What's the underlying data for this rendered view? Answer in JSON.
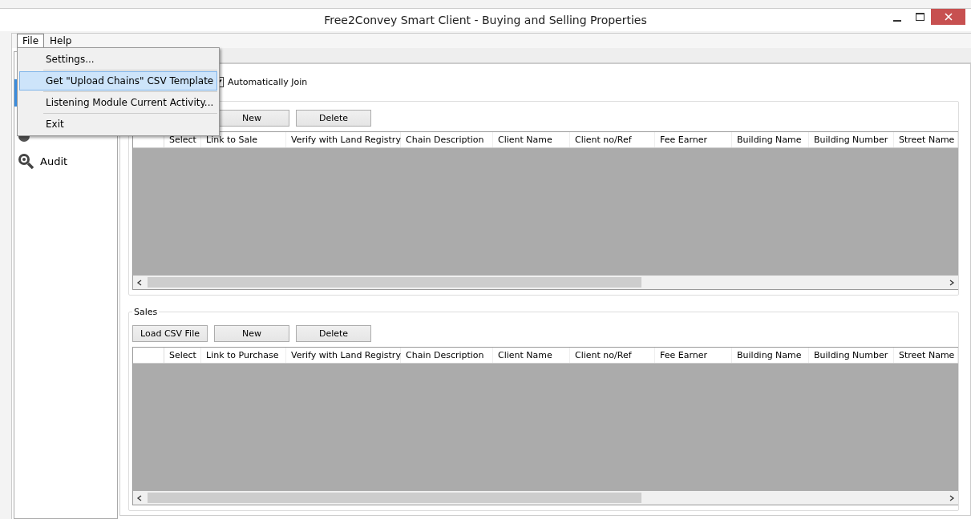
{
  "window": {
    "title": "Free2Convey Smart Client - Buying and Selling Properties"
  },
  "menu_bar": [
    {
      "label": "File",
      "selected": true
    },
    {
      "label": "Help",
      "selected": false
    }
  ],
  "file_menu": [
    {
      "label": "Settings...",
      "selected": false
    },
    {
      "label": "Get \"Upload Chains\" CSV Template",
      "selected": true
    },
    {
      "label": "Listening Module Current Activity...",
      "selected": false
    },
    {
      "label": "Exit",
      "selected": false
    }
  ],
  "sidebar": {
    "items": [
      {
        "label": "Audit",
        "selected": false
      }
    ]
  },
  "auto_join": {
    "label": "Automatically Join",
    "checked": true
  },
  "purchases": {
    "buttons": [
      "New",
      "Delete"
    ],
    "columns": [
      "Select",
      "Link to Sale",
      "Verify with Land Registry",
      "Chain Description",
      "Client Name",
      "Client no/Ref",
      "Fee Earner",
      "Building Name",
      "Building Number",
      "Street Name"
    ]
  },
  "sales": {
    "title": "Sales",
    "buttons": [
      "Load CSV File",
      "New",
      "Delete"
    ],
    "columns": [
      "Select",
      "Link to Purchase",
      "Verify with Land Registry",
      "Chain Description",
      "Client Name",
      "Client no/Ref",
      "Fee Earner",
      "Building Name",
      "Building Number",
      "Street Name"
    ]
  }
}
